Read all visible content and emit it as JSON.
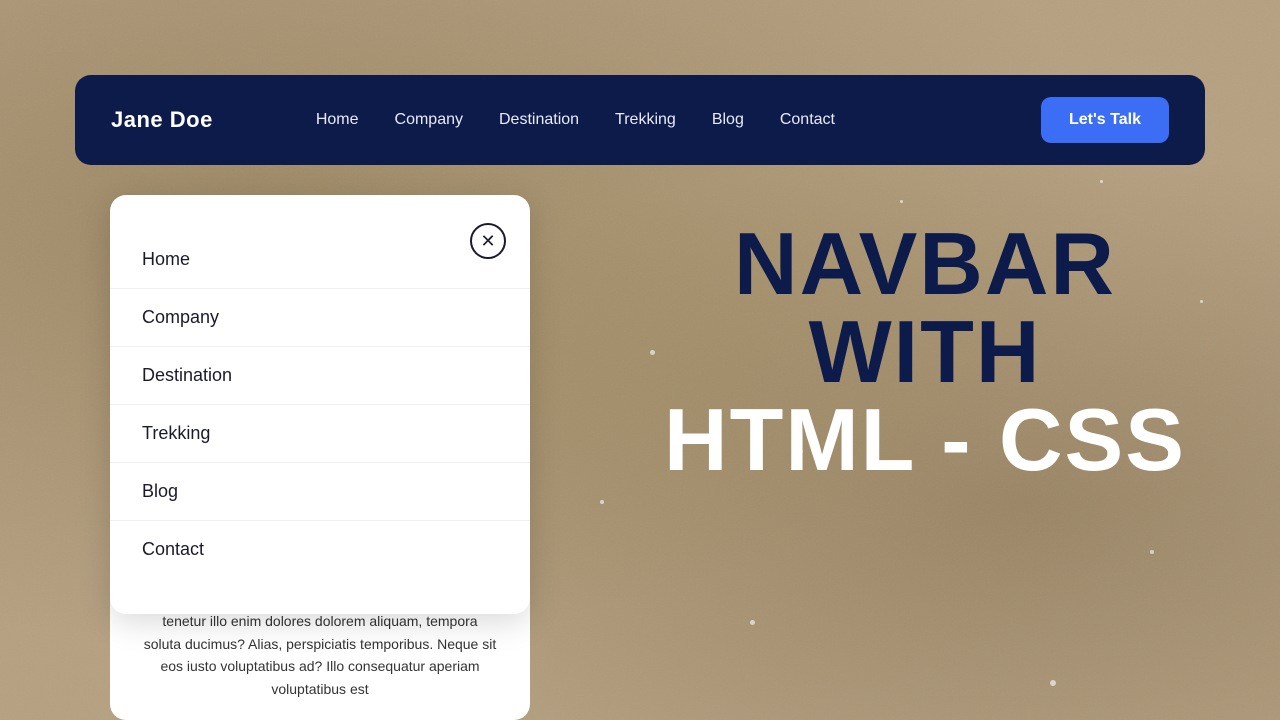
{
  "brand": {
    "name": "Jane Doe"
  },
  "navbar": {
    "links": [
      {
        "label": "Home",
        "id": "home"
      },
      {
        "label": "Company",
        "id": "company"
      },
      {
        "label": "Destination",
        "id": "destination"
      },
      {
        "label": "Trekking",
        "id": "trekking"
      },
      {
        "label": "Blog",
        "id": "blog"
      },
      {
        "label": "Contact",
        "id": "contact"
      }
    ],
    "cta": "Let's Talk"
  },
  "mobile_menu": {
    "items": [
      {
        "label": "Home"
      },
      {
        "label": "Company"
      },
      {
        "label": "Destination"
      },
      {
        "label": "Trekking"
      },
      {
        "label": "Blog"
      },
      {
        "label": "Contact"
      }
    ]
  },
  "hero": {
    "line1": "NAVBAR",
    "line2": "WITH",
    "line3": "HTML - CSS"
  },
  "bottom_text": "tenetur illo enim dolores dolorem aliquam, tempora soluta ducimus? Alias, perspiciatis temporibus. Neque sit eos iusto voluptatibus ad? Illo consequatur aperiam voluptatibus est"
}
